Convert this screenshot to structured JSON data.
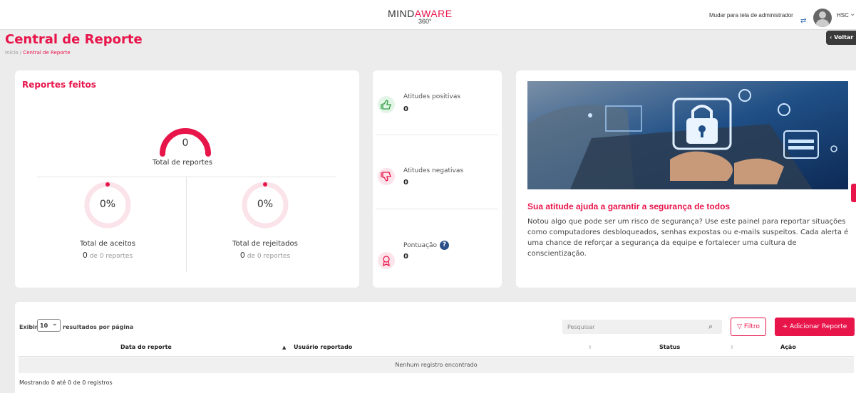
{
  "header": {
    "logo_part1": "MIND",
    "logo_part2": "AWARE",
    "logo_sub": "360°",
    "admin_switch": "Mudar para tela de administrador",
    "user": "HSC"
  },
  "page": {
    "title": "Central de Reporte",
    "breadcrumb_home": "Início",
    "breadcrumb_sep": " / ",
    "breadcrumb_current": "Central de Reporte",
    "back_label": "Voltar"
  },
  "reports": {
    "title": "Reportes feitos",
    "total_value": "0",
    "total_label": "Total de reportes",
    "accepted": {
      "pct": "0%",
      "label": "Total de aceitos",
      "count": "0",
      "of": " de 0 reportes",
      "fraction": 0
    },
    "rejected": {
      "pct": "0%",
      "label": "Total de rejeitados",
      "count": "0",
      "of": " de 0 reportes",
      "fraction": 0
    }
  },
  "attitudes": {
    "positive": {
      "label": "Atitudes positivas",
      "value": "0",
      "icon": "thumbs-up-icon",
      "color": "#2ea043"
    },
    "negative": {
      "label": "Atitudes negativas",
      "value": "0",
      "icon": "thumbs-down-icon",
      "color": "#e8154b"
    },
    "score": {
      "label": "Pontuação",
      "value": "0",
      "icon": "award-icon",
      "help": "?"
    }
  },
  "info": {
    "title": "Sua atitude ajuda a garantir a segurança de todos",
    "text": "Notou algo que pode ser um risco de segurança? Use este painel para reportar situações como computadores desbloqueados, senhas expostas ou e-mails suspeitos. Cada alerta é uma chance de reforçar a segurança da equipe e fortalecer uma cultura de conscientização."
  },
  "table": {
    "show_label": "Exibir",
    "page_size": "10",
    "per_page_label": "resultados por página",
    "search_placeholder": "Pesquisar",
    "filter_label": "▽ Filtro",
    "add_label": "+ Adicionar Reporte",
    "columns": [
      "Data do reporte",
      "Usuário reportado",
      "Status",
      "Ação"
    ],
    "empty": "Nenhum registro encontrado",
    "footer": "Mostrando 0 até 0 de 0 registros"
  },
  "colors": {
    "accent": "#e8154b",
    "positive": "#2ea043"
  }
}
